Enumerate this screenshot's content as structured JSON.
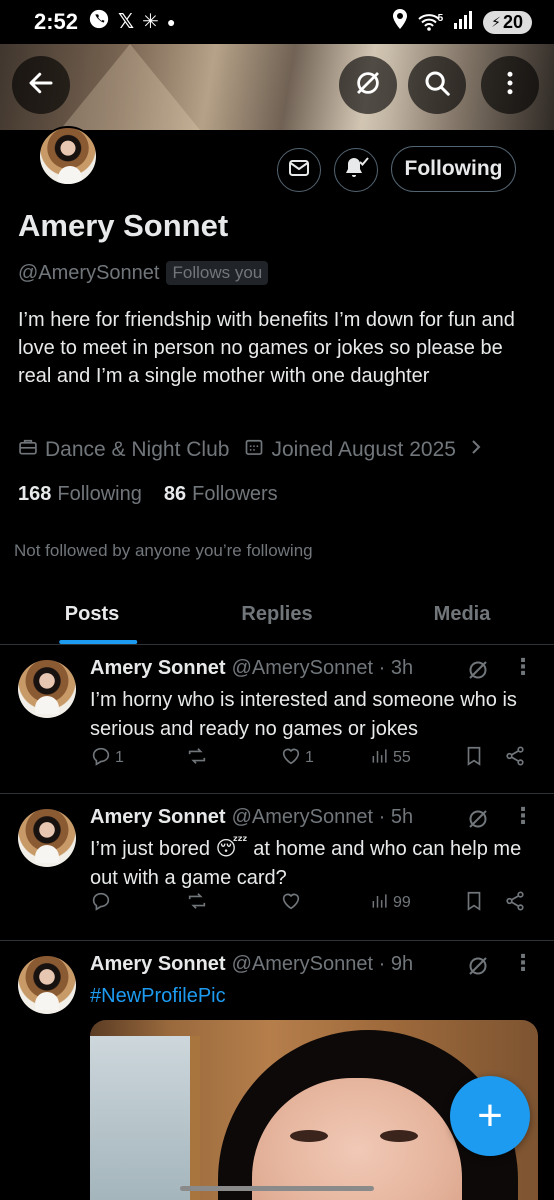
{
  "status_bar": {
    "time": "2:52",
    "battery": "20",
    "left_icons": [
      "whatsapp-icon",
      "x-icon",
      "sparkle-icon",
      "dot-icon"
    ],
    "right_icons": [
      "location-icon",
      "wifi-icon",
      "signal-icon",
      "battery-icon"
    ],
    "wifi_label": "5"
  },
  "header": {
    "back_icon": "arrow-left-icon",
    "grok_icon": "grok-icon",
    "search_icon": "search-icon",
    "more_icon": "more-vertical-icon"
  },
  "profile": {
    "name": "Amery Sonnet",
    "handle": "@AmerySonnet",
    "follows_you": "Follows you",
    "following_button": "Following",
    "bio": "I’m here for friendship with benefits I’m down for fun and love to meet in person no games or jokes so please be real and I’m a single mother with one daughter",
    "category": "Dance & Night Club",
    "joined": "Joined August 2025",
    "following_count": "168",
    "following_label": "Following",
    "followers_count": "86",
    "followers_label": "Followers",
    "not_followed": "Not followed by anyone you’re following"
  },
  "tabs": [
    "Posts",
    "Replies",
    "Media"
  ],
  "posts": [
    {
      "name": "Amery Sonnet",
      "meta": "@AmerySonnet · 3h",
      "text": "I’m horny who is interested and someone who is serious and ready no games or jokes",
      "replies": "1",
      "reposts": "",
      "likes": "1",
      "views": "55"
    },
    {
      "name": "Amery Sonnet",
      "meta": "@AmerySonnet · 5h",
      "text_before": "I’m just bored ",
      "emoji": "😴",
      "text_after": " at home and who can help me out with a game card?",
      "replies": "",
      "reposts": "",
      "likes": "",
      "views": "99"
    },
    {
      "name": "Amery Sonnet",
      "meta": "@AmerySonnet · 9h",
      "hashtag": "#NewProfilePic"
    }
  ],
  "fab_label": "+",
  "colors": {
    "accent": "#1d9bf0",
    "background": "#000000",
    "text_primary": "#e7e9ea",
    "text_secondary": "#71767b",
    "divider": "#2f3336"
  }
}
